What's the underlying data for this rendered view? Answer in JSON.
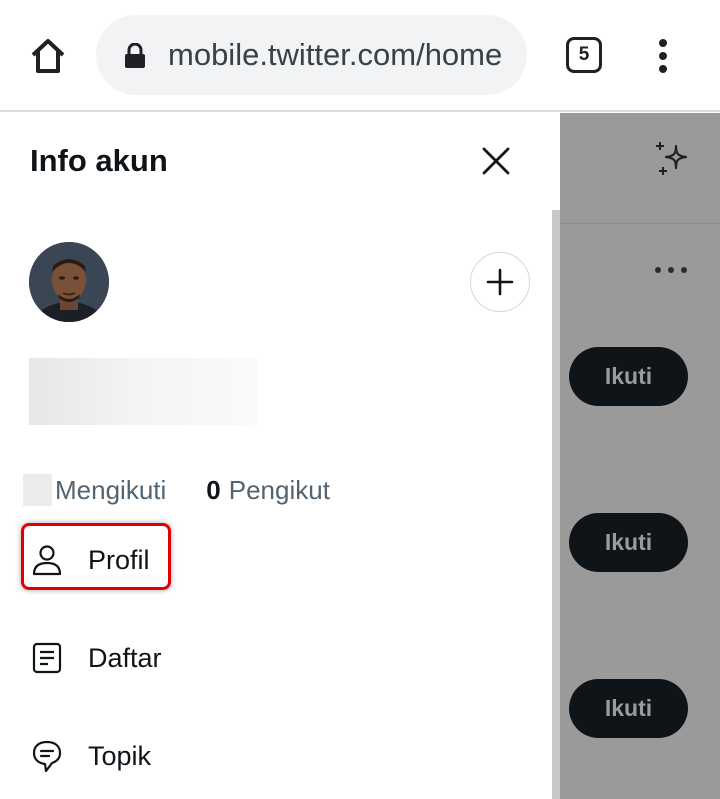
{
  "browser": {
    "url": "mobile.twitter.com/home",
    "tab_count": "5",
    "icons": {
      "home": "home-icon",
      "lock": "lock-icon",
      "menu": "kebab-menu-icon"
    }
  },
  "drawer": {
    "title": "Info akun",
    "stats": {
      "following_label": "Mengikuti",
      "followers_count": "0",
      "followers_label": "Pengikut"
    },
    "menu": [
      {
        "label": "Profil",
        "icon": "person-icon"
      },
      {
        "label": "Daftar",
        "icon": "list-icon"
      },
      {
        "label": "Topik",
        "icon": "topic-icon"
      }
    ]
  },
  "background": {
    "follow_buttons": [
      "Ikuti",
      "Ikuti",
      "Ikuti"
    ]
  },
  "colors": {
    "highlight": "#e00000",
    "text_primary": "#0f1419",
    "text_secondary": "#536471"
  }
}
